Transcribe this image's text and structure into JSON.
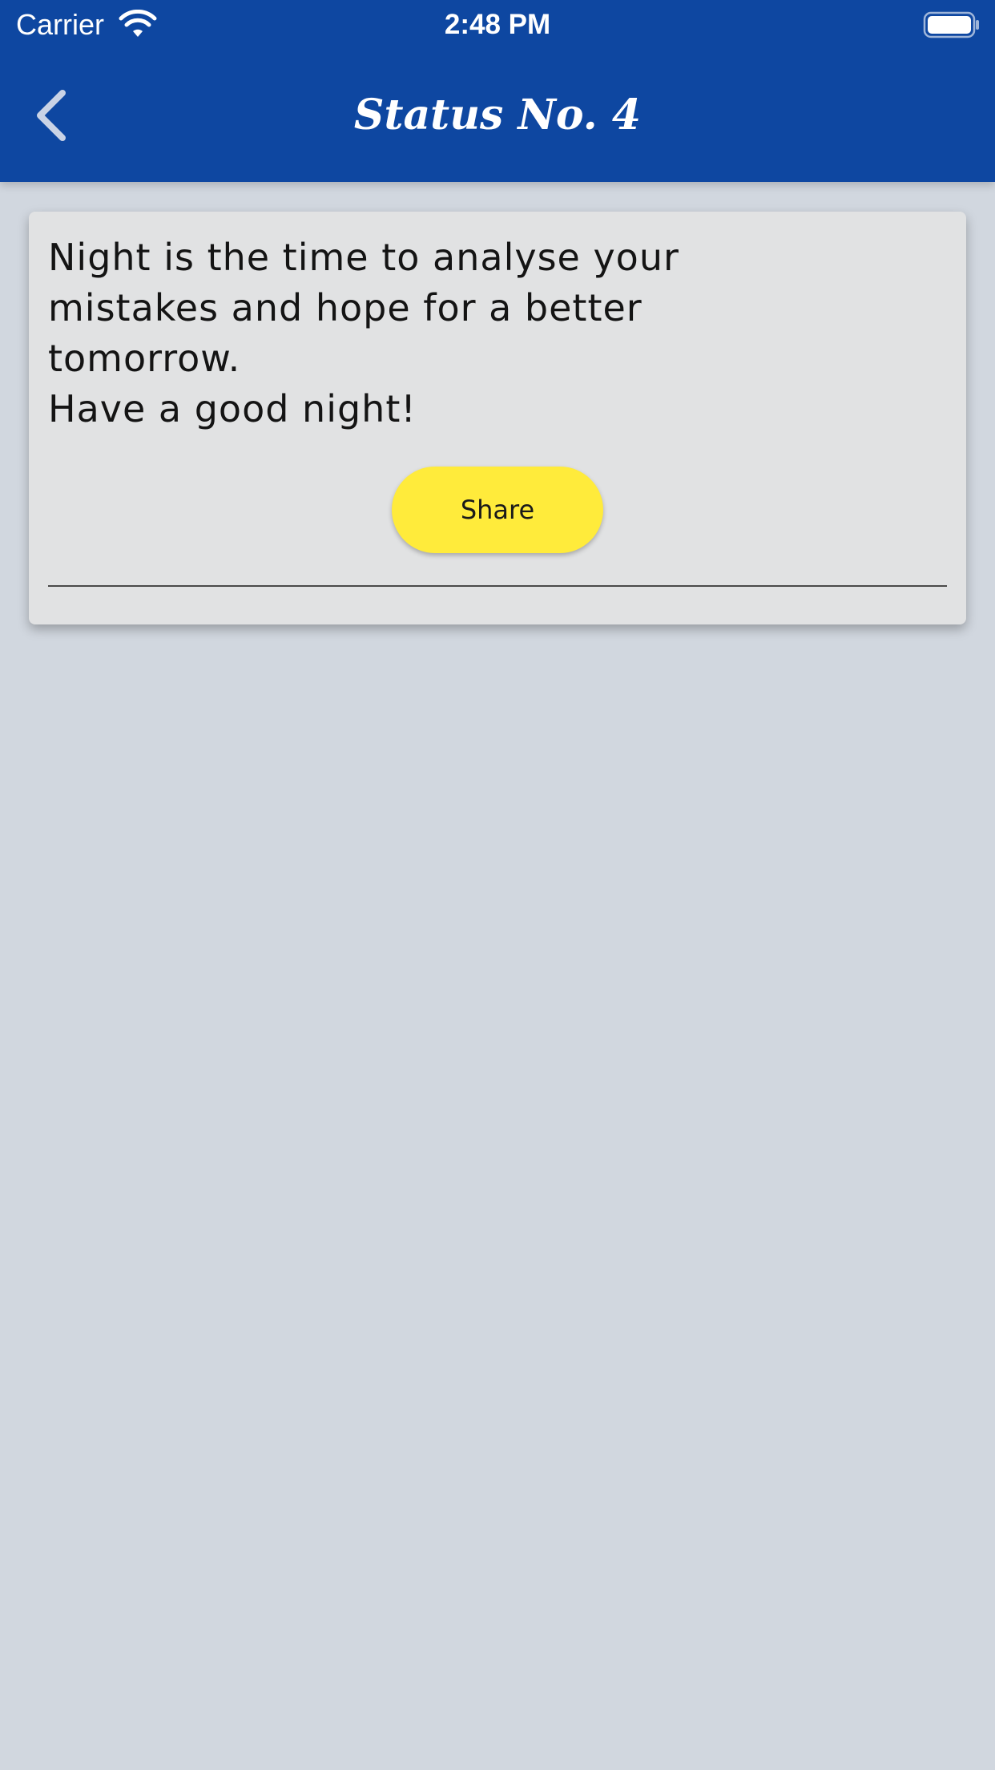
{
  "status_bar": {
    "carrier": "Carrier",
    "time": "2:48 PM",
    "wifi_icon": "wifi-icon",
    "battery_icon": "battery-icon"
  },
  "nav": {
    "title": "Status No. 4",
    "back_icon": "chevron-left-icon"
  },
  "card": {
    "quote": "Night is the time to analyse your\nmistakes and hope for a better\ntomorrow.\nHave a good night!",
    "share_label": "Share"
  },
  "colors": {
    "header": "#0e47a1",
    "background": "#d1d7df",
    "card": "#e1e2e3",
    "share_button": "#ffeb3b"
  }
}
